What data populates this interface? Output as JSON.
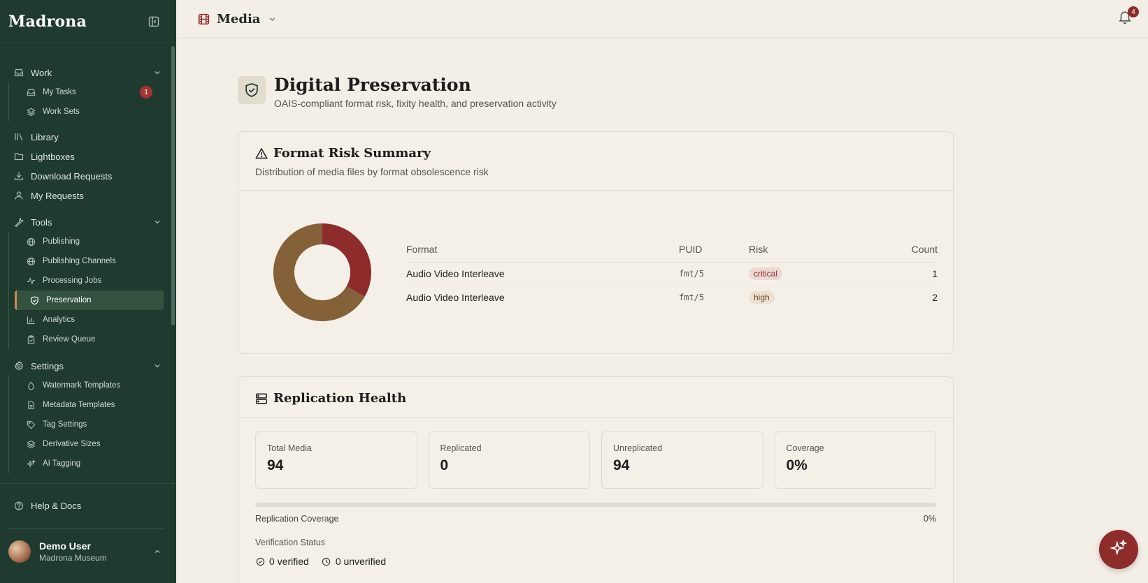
{
  "brand": "Madrona",
  "sidebar": {
    "groups": [
      {
        "label": "Work",
        "items": [
          {
            "label": "My Tasks",
            "badge": "1"
          },
          {
            "label": "Work Sets"
          }
        ]
      },
      {
        "label": "Tools",
        "items": [
          {
            "label": "Publishing"
          },
          {
            "label": "Publishing Channels"
          },
          {
            "label": "Processing Jobs"
          },
          {
            "label": "Preservation"
          },
          {
            "label": "Analytics"
          },
          {
            "label": "Review Queue"
          }
        ]
      },
      {
        "label": "Settings",
        "items": [
          {
            "label": "Watermark Templates"
          },
          {
            "label": "Metadata Templates"
          },
          {
            "label": "Tag Settings"
          },
          {
            "label": "Derivative Sizes"
          },
          {
            "label": "AI Tagging"
          }
        ]
      }
    ],
    "top_items": [
      {
        "label": "Library"
      },
      {
        "label": "Lightboxes"
      },
      {
        "label": "Download Requests"
      },
      {
        "label": "My Requests"
      }
    ],
    "help": "Help & Docs",
    "user": {
      "name": "Demo User",
      "org": "Madrona Museum"
    }
  },
  "topbar": {
    "section": "Media",
    "notifications": "4"
  },
  "page": {
    "title": "Digital Preservation",
    "subtitle": "OAIS-compliant format risk, fixity health, and preservation activity"
  },
  "risk": {
    "title": "Format Risk Summary",
    "desc": "Distribution of media files by format obsolescence risk",
    "headers": {
      "format": "Format",
      "puid": "PUID",
      "risk": "Risk",
      "count": "Count"
    },
    "rows": [
      {
        "format": "Audio Video Interleave",
        "puid": "fmt/5",
        "risk": "critical",
        "count": "1"
      },
      {
        "format": "Audio Video Interleave",
        "puid": "fmt/5",
        "risk": "high",
        "count": "2"
      }
    ]
  },
  "chart_data": {
    "type": "pie",
    "categories": [
      "critical",
      "high"
    ],
    "values": [
      1,
      2
    ],
    "colors": [
      "#8e2b2b",
      "#85613a"
    ]
  },
  "replication": {
    "title": "Replication Health",
    "stats": [
      {
        "label": "Total Media",
        "value": "94"
      },
      {
        "label": "Replicated",
        "value": "0"
      },
      {
        "label": "Unreplicated",
        "value": "94"
      },
      {
        "label": "Coverage",
        "value": "0%"
      }
    ],
    "coverage_label": "Replication Coverage",
    "coverage_value": "0%",
    "coverage_fraction": 0,
    "verification_label": "Verification Status",
    "verified": "0 verified",
    "unverified": "0 unverified"
  }
}
